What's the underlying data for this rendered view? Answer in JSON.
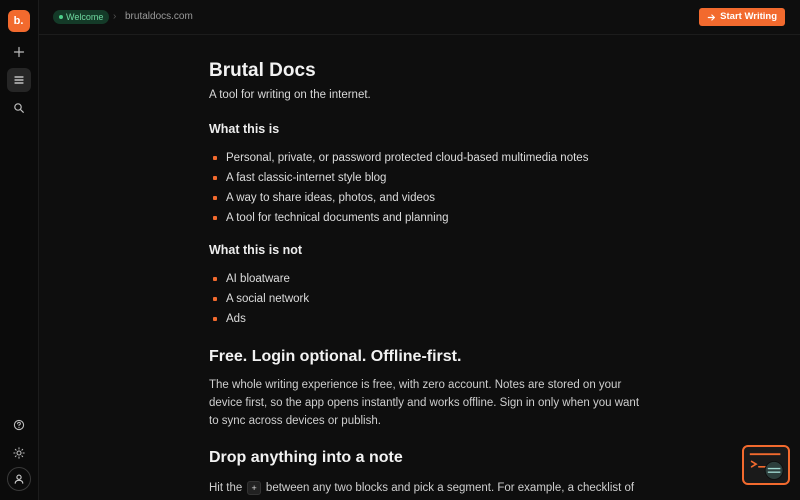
{
  "sidebar": {
    "logo_text": "b.",
    "icons": [
      "plus-icon",
      "document-list-icon",
      "search-icon",
      "help-icon",
      "theme-icon",
      "account-icon"
    ],
    "active": "document-list-icon"
  },
  "topbar": {
    "badge": "Welcome",
    "breadcrumb_sep": "›",
    "breadcrumb": "brutaldocs.com",
    "start_button": "Start Writing"
  },
  "doc": {
    "title": "Brutal Docs",
    "tagline": "A tool for writing on the internet.",
    "section1": {
      "heading": "What this is",
      "items": [
        "Personal, private, or password protected cloud-based multimedia notes",
        "A fast classic-internet style blog",
        "A way to share ideas, photos, and videos",
        "A tool for technical documents and planning"
      ]
    },
    "section2": {
      "heading": "What this is not",
      "items": [
        "AI bloatware",
        "A social network",
        "Ads"
      ]
    },
    "section3": {
      "heading": "Free. Login optional. Offline-first.",
      "body": "The whole writing experience is free, with zero account. Notes are stored on your device first, so the app opens instantly and works offline. Sign in only when you want to sync across devices or publish."
    },
    "section4": {
      "heading": "Drop anything into a note",
      "body_pre": "Hit the",
      "body_key": "+",
      "body_post": "between any two blocks and pick a segment. For example, a checklist of"
    }
  },
  "colors": {
    "accent": "#f26a2e",
    "background": "#0e0e0e",
    "badge_bg": "#143a28",
    "badge_text": "#6fd8a0"
  }
}
